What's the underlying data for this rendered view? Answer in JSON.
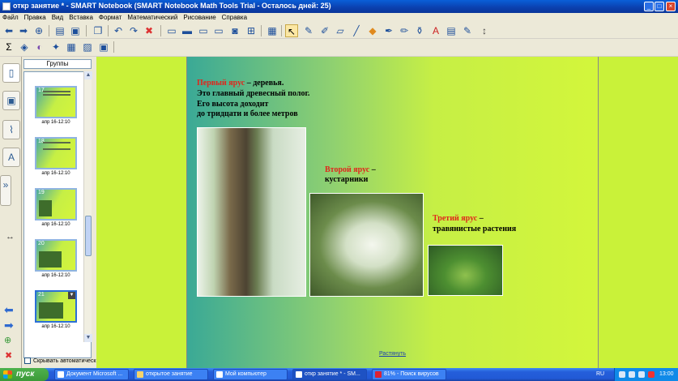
{
  "window": {
    "title": "откр занятие * - SMART Notebook (SMART Notebook Math Tools Trial - Осталось дней: 25)"
  },
  "menu": [
    "Файл",
    "Правка",
    "Вид",
    "Вставка",
    "Формат",
    "Математический",
    "Рисование",
    "Справка"
  ],
  "sorter": {
    "groups_label": "Группы",
    "autohide_label": "Скрывать автоматически",
    "pages": [
      {
        "num": "17",
        "label": "апр 16-12:10"
      },
      {
        "num": "18",
        "label": "апр 16-12:10"
      },
      {
        "num": "19",
        "label": "апр 16-12:10"
      },
      {
        "num": "20",
        "label": "апр 16-12:10"
      },
      {
        "num": "21",
        "label": "апр 16-12:10"
      }
    ]
  },
  "slide": {
    "tier1": {
      "red": "Первый ярус",
      "rest": " – деревья.",
      "l2": "Это главный древесный полог.",
      "l3": "Его высота доходит",
      "l4": "до тридцати и более метров"
    },
    "tier2": {
      "red": "Второй ярус",
      "rest": " –",
      "l2": "кустарники"
    },
    "tier3": {
      "red": "Третий ярус",
      "rest": " –",
      "l2": "травянистые растения"
    },
    "stretch_link": "Растянуть"
  },
  "taskbar": {
    "start": "пуск",
    "tasks": [
      "Документ Microsoft ...",
      "открытое занятие",
      "Мой компьютер",
      "откр занятие * - SM...",
      "81% - Поиск вирусов"
    ],
    "lang": "RU",
    "clock": "13:00"
  }
}
